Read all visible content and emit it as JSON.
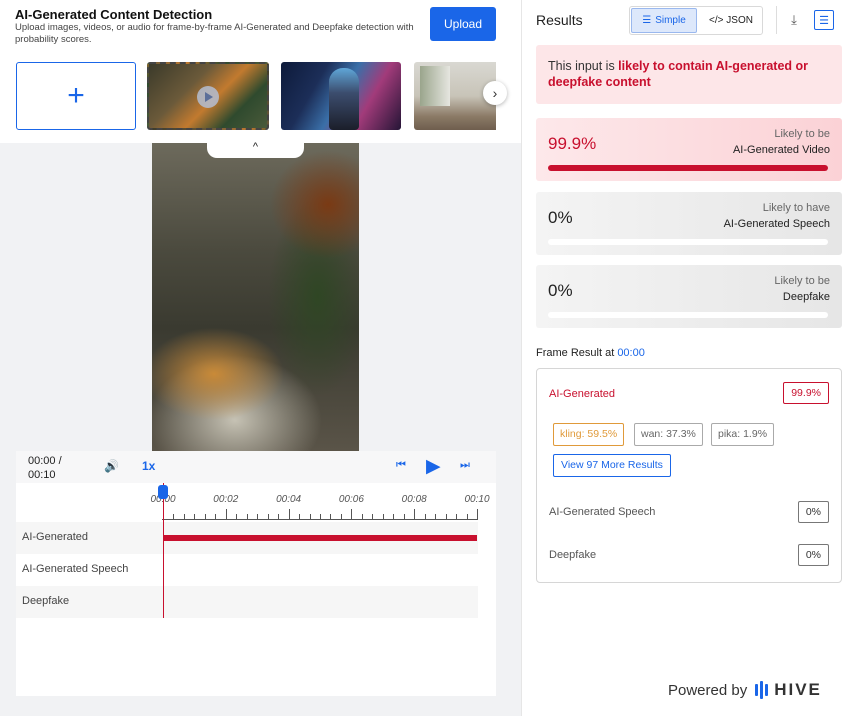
{
  "header": {
    "title": "AI-Generated Content Detection",
    "description": "Upload images, videos, or audio for frame-by-frame AI-Generated and Deepfake detection with probability scores.",
    "upload_label": "Upload"
  },
  "gallery": {
    "add_symbol": "+",
    "next_symbol": "›",
    "collapse_symbol": "^"
  },
  "player": {
    "time_current": "00:00 /",
    "time_total": "00:10",
    "speed": "1x",
    "timeline_ticks": [
      "00:00",
      "00:02",
      "00:04",
      "00:06",
      "00:08",
      "00:10"
    ],
    "tracks": [
      {
        "label": "AI-Generated",
        "fill": 1.0
      },
      {
        "label": "AI-Generated Speech",
        "fill": 0
      },
      {
        "label": "Deepfake",
        "fill": 0
      }
    ]
  },
  "results": {
    "title": "Results",
    "view_simple": "Simple",
    "view_json": "</> JSON",
    "verdict_prefix": "This input is ",
    "verdict_highlight": "likely to contain AI-generated or deepfake content",
    "cards": [
      {
        "pct": "99.9%",
        "likely": "Likely to be",
        "kind": "AI-Generated Video",
        "fill": 0.999
      },
      {
        "pct": "0%",
        "likely": "Likely to have",
        "kind": "AI-Generated Speech",
        "fill": 0
      },
      {
        "pct": "0%",
        "likely": "Likely to be",
        "kind": "Deepfake",
        "fill": 0
      }
    ],
    "frame_result_label": "Frame Result at",
    "frame_time": "00:00",
    "frame": {
      "ai_label": "AI-Generated",
      "ai_score": "99.9%",
      "sources": [
        "kling: 59.5%",
        "wan: 37.3%",
        "pika: 1.9%"
      ],
      "more_label": "View 97 More Results",
      "speech_label": "AI-Generated Speech",
      "speech_score": "0%",
      "deepfake_label": "Deepfake",
      "deepfake_score": "0%"
    },
    "powered_by": "Powered by",
    "brand": "HIVE"
  },
  "colors": {
    "accent": "#1a66e8",
    "danger": "#c8102e",
    "source_top": "#e09a3a"
  }
}
